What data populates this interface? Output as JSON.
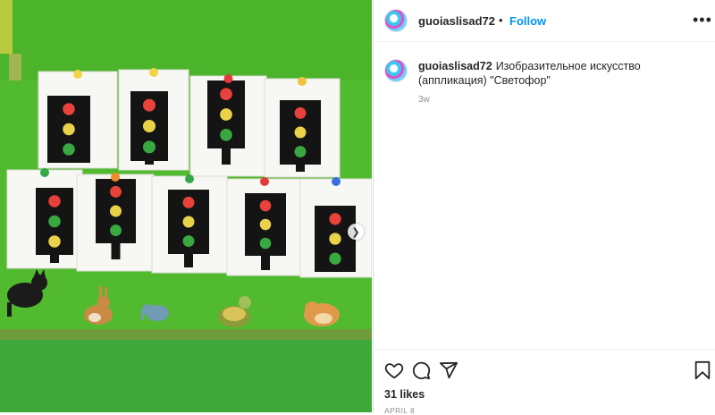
{
  "post": {
    "username": "guoiaslisad72",
    "follow_label": "Follow",
    "separator": "•",
    "more_label": "•••",
    "caption_user": "guoiaslisad72",
    "caption_text": "Изобразительное искусство (аппликация) \"Светофор\"",
    "time_ago": "3w",
    "likes": "31 likes",
    "date": "APRIL 8"
  },
  "media": {
    "description_icons": [
      "traffic-light-artwork",
      "cat-sticker",
      "rabbit-sticker",
      "elephant-sticker",
      "turtle-sticker",
      "hamster-sticker"
    ]
  },
  "icons": {
    "like": "heart-icon",
    "comment": "comment-icon",
    "share": "share-icon",
    "save": "bookmark-icon",
    "next": "chevron-right-icon"
  },
  "colors": {
    "accent": "#0095f6",
    "wall": "#4fb82c",
    "light_red": "#e8423a",
    "light_yellow": "#e9d24a",
    "light_green": "#3aa840"
  }
}
